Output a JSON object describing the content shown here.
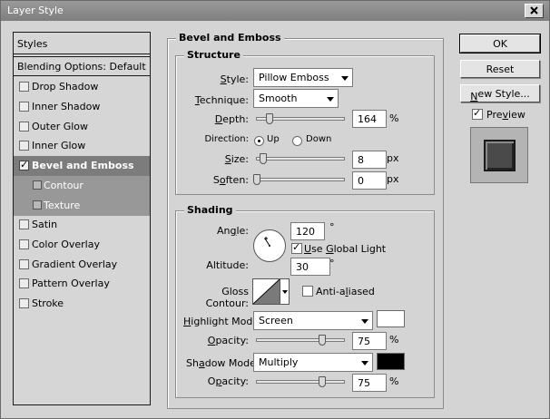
{
  "window": {
    "title": "Layer Style"
  },
  "styles_panel": {
    "header": "Styles",
    "blending_options": "Blending Options: Default",
    "items": [
      {
        "label": "Drop Shadow",
        "checked": false
      },
      {
        "label": "Inner Shadow",
        "checked": false
      },
      {
        "label": "Outer Glow",
        "checked": false
      },
      {
        "label": "Inner Glow",
        "checked": false
      },
      {
        "label": "Bevel and Emboss",
        "checked": true,
        "selected": true
      },
      {
        "label": "Contour",
        "checked": false,
        "sub": true
      },
      {
        "label": "Texture",
        "checked": false,
        "sub": true
      },
      {
        "label": "Satin",
        "checked": false
      },
      {
        "label": "Color Overlay",
        "checked": false
      },
      {
        "label": "Gradient Overlay",
        "checked": false
      },
      {
        "label": "Pattern Overlay",
        "checked": false
      },
      {
        "label": "Stroke",
        "checked": false
      }
    ]
  },
  "bevel": {
    "title": "Bevel and Emboss",
    "structure": {
      "title": "Structure",
      "style_label": "Style:",
      "style_value": "Pillow Emboss",
      "technique_label": "Technique:",
      "technique_value": "Smooth",
      "depth_label": "Depth:",
      "depth_value": "164",
      "depth_unit": "%",
      "direction_label": "Direction:",
      "direction_up": "Up",
      "direction_down": "Down",
      "direction_selected": "Up",
      "size_label": "Size:",
      "size_value": "8",
      "size_unit": "px",
      "soften_label": "Soften:",
      "soften_value": "0",
      "soften_unit": "px"
    },
    "shading": {
      "title": "Shading",
      "angle_label": "Angle:",
      "angle_value": "120",
      "angle_unit": "°",
      "use_global_light_label": "Use Global Light",
      "use_global_light": true,
      "altitude_label": "Altitude:",
      "altitude_value": "30",
      "altitude_unit": "°",
      "gloss_contour_label": "Gloss Contour:",
      "anti_aliased_label": "Anti-aliased",
      "anti_aliased": false,
      "highlight_mode_label": "Highlight Mode:",
      "highlight_mode_value": "Screen",
      "highlight_color": "#ffffff",
      "highlight_opacity_label": "Opacity:",
      "highlight_opacity_value": "75",
      "highlight_opacity_unit": "%",
      "shadow_mode_label": "Shadow Mode:",
      "shadow_mode_value": "Multiply",
      "shadow_color": "#000000",
      "shadow_opacity_label": "Opacity:",
      "shadow_opacity_value": "75",
      "shadow_opacity_unit": "%"
    }
  },
  "buttons": {
    "ok": "OK",
    "reset": "Reset",
    "new_style": "New Style...",
    "preview_label": "Preview",
    "preview_checked": true
  }
}
